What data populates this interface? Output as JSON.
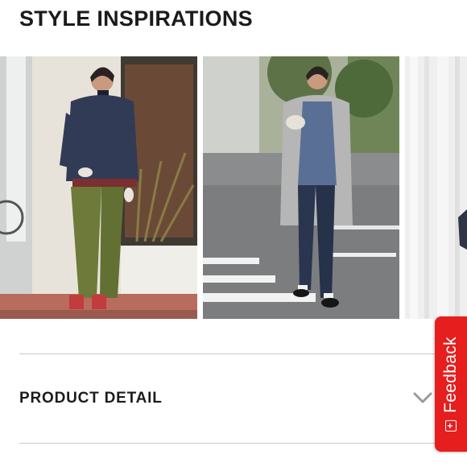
{
  "section": {
    "title": "STYLE INSPIRATIONS"
  },
  "carousel": {
    "images": [
      {
        "description": "outfit-navy-puffer-jacket-olive-pants"
      },
      {
        "description": "outfit-grey-hooded-coat-navy-leggings"
      },
      {
        "description": "outfit-partial-next-slide"
      }
    ]
  },
  "product_detail": {
    "label": "PRODUCT DETAIL",
    "chevron_icon": "chevron-down-icon"
  },
  "feedback": {
    "label": "Feedback",
    "icon_glyph": "+",
    "icon": "plus-box-icon",
    "color": "#e61e1e"
  }
}
